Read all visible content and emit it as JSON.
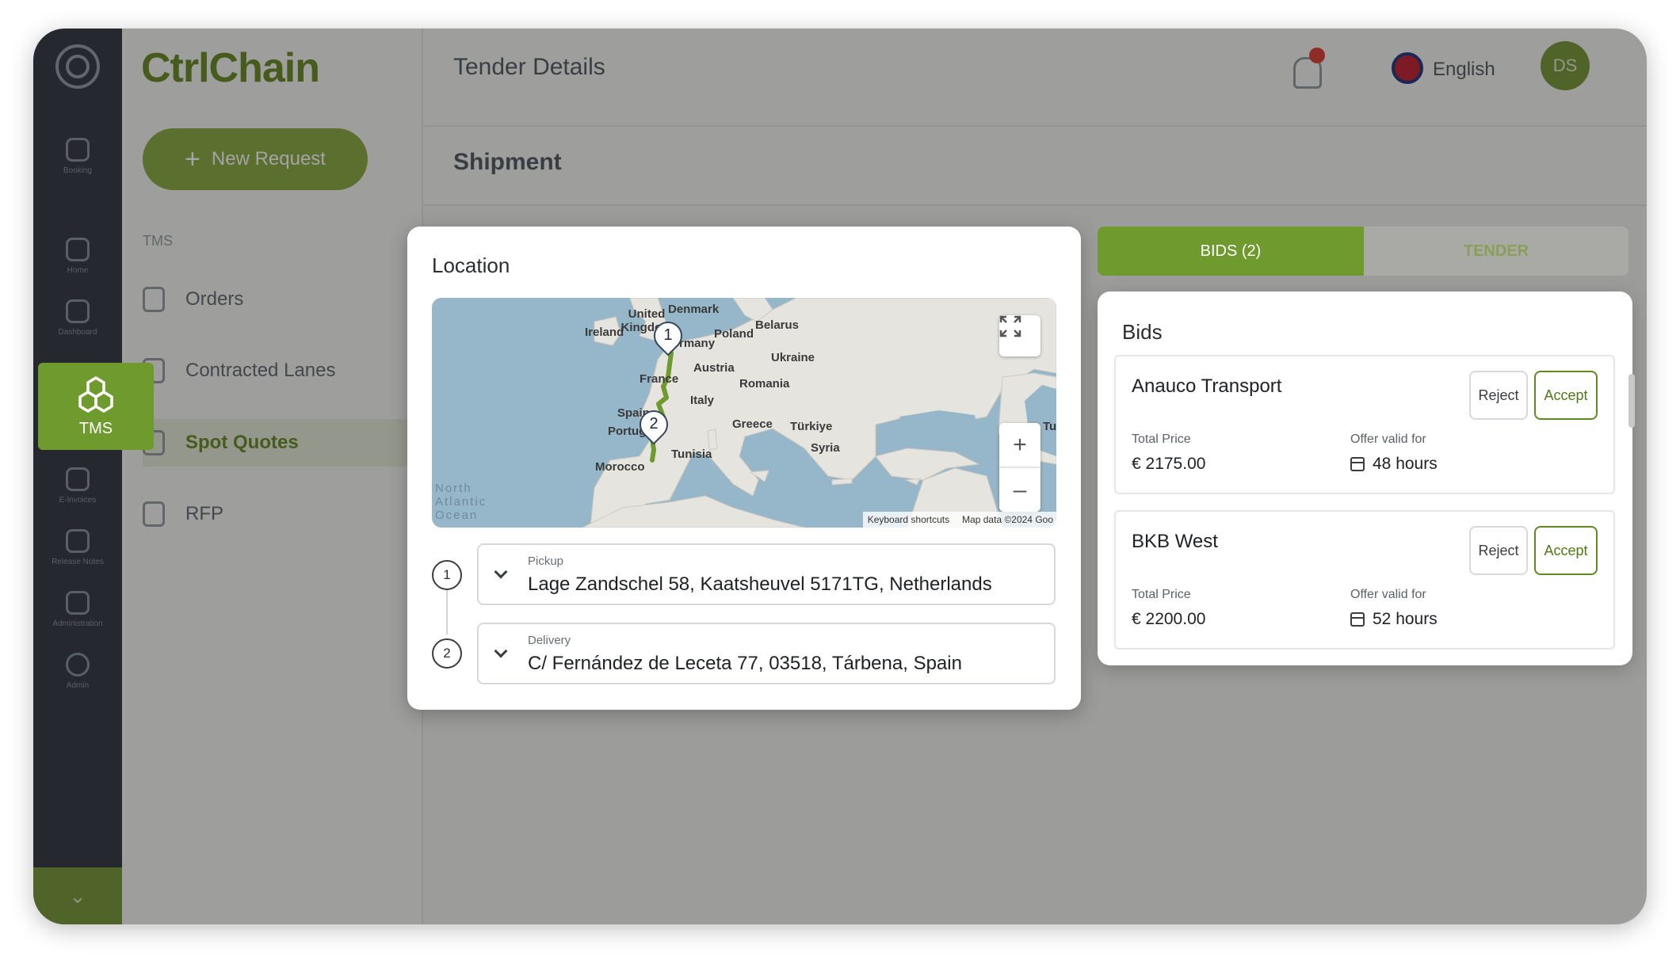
{
  "app": {
    "brand": "CtrlChain",
    "page_title": "Tender Details",
    "section_title": "Shipment"
  },
  "header": {
    "language": "English",
    "avatar_initials": "DS"
  },
  "rail": {
    "items": [
      {
        "label": "Booking",
        "icon": "booking-icon"
      },
      {
        "label": "Home",
        "icon": "home-icon"
      },
      {
        "label": "Dashboard",
        "icon": "dashboard-icon"
      },
      {
        "label": "TMS",
        "icon": "cubes-icon"
      },
      {
        "label": "E-Invoices",
        "icon": "invoice-icon"
      },
      {
        "label": "Release Notes",
        "icon": "notes-icon"
      },
      {
        "label": "Administration",
        "icon": "admin-icon"
      },
      {
        "label": "Admin",
        "icon": "gear-icon"
      }
    ]
  },
  "sidebar": {
    "new_request": "New Request",
    "section": "TMS",
    "items": [
      {
        "label": "Orders"
      },
      {
        "label": "Contracted Lanes"
      },
      {
        "label": "Spot Quotes"
      },
      {
        "label": "RFP"
      }
    ]
  },
  "location": {
    "title": "Location",
    "map": {
      "labels": [
        "Denmark",
        "United Kingdom",
        "Ireland",
        "Belarus",
        "Poland",
        "Germany",
        "Ukraine",
        "Austria",
        "France",
        "Romania",
        "Italy",
        "Spain",
        "Greece",
        "Türkiye",
        "Portugal",
        "Syria",
        "Tunisia",
        "Morocco",
        "Tu"
      ],
      "ocean_label": "North Atlantic Ocean",
      "pins": [
        "1",
        "2"
      ],
      "attribution": {
        "shortcuts": "Keyboard shortcuts",
        "data": "Map data ©2024 Goo"
      },
      "route_color": "#6f9a2d"
    },
    "stops": [
      {
        "number": "1",
        "label": "Pickup",
        "value": "Lage Zandschel 58, Kaatsheuvel 5171TG, Netherlands"
      },
      {
        "number": "2",
        "label": "Delivery",
        "value": "C/ Fernández de Leceta 77, 03518, Tárbena, Spain"
      }
    ]
  },
  "tabs": {
    "bids": "BIDS (2)",
    "tender": "TENDER"
  },
  "bids": {
    "title": "Bids",
    "reject_label": "Reject",
    "accept_label": "Accept",
    "price_label": "Total Price",
    "validity_label": "Offer valid for",
    "items": [
      {
        "carrier": "Anauco Transport",
        "price": "€ 2175.00",
        "validity": "48 hours"
      },
      {
        "carrier": "BKB West",
        "price": "€ 2200.00",
        "validity": "52 hours"
      }
    ]
  },
  "colors": {
    "accent": "#6f9a2d",
    "notification": "#e2453c"
  }
}
